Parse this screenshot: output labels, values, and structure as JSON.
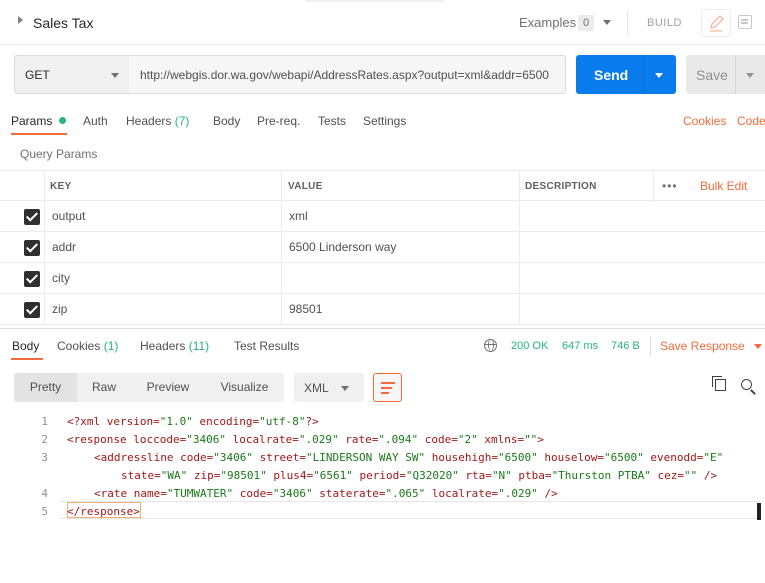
{
  "header": {
    "title": "Sales Tax",
    "examples_label": "Examples",
    "examples_count": "0",
    "build_label": "BUILD"
  },
  "request": {
    "method": "GET",
    "url": "http://webgis.dor.wa.gov/webapi/AddressRates.aspx?output=xml&addr=6500",
    "send_label": "Send",
    "save_label": "Save"
  },
  "request_tabs": {
    "params": "Params",
    "auth": "Auth",
    "headers": "Headers",
    "headers_count": "(7)",
    "body": "Body",
    "prereq": "Pre-req.",
    "tests": "Tests",
    "settings": "Settings",
    "cookies": "Cookies",
    "code": "Code"
  },
  "query_params": {
    "title": "Query Params",
    "columns": {
      "key": "KEY",
      "value": "VALUE",
      "description": "DESCRIPTION"
    },
    "more": "•••",
    "bulk_edit": "Bulk Edit",
    "rows": [
      {
        "key": "output",
        "value": "xml",
        "description": ""
      },
      {
        "key": "addr",
        "value": "6500 Linderson way",
        "description": ""
      },
      {
        "key": "city",
        "value": "",
        "description": ""
      },
      {
        "key": "zip",
        "value": "98501",
        "description": ""
      }
    ]
  },
  "response_tabs": {
    "body": "Body",
    "cookies": "Cookies",
    "cookies_count": "(1)",
    "headers": "Headers",
    "headers_count": "(11)",
    "test_results": "Test Results"
  },
  "response_status": {
    "status": "200 OK",
    "time": "647 ms",
    "size": "746 B",
    "save_response": "Save Response"
  },
  "view": {
    "pretty": "Pretty",
    "raw": "Raw",
    "preview": "Preview",
    "visualize": "Visualize",
    "format": "XML"
  },
  "code_lines": [
    "1",
    "2",
    "3",
    "4",
    "5"
  ],
  "code": {
    "l1": {
      "pi": "<?xml",
      "a1": " version=",
      "v1": "\"1.0\"",
      "a2": " encoding=",
      "v2": "\"utf-8\"",
      "end": "?>"
    },
    "l2": {
      "tag": "<response",
      "a1": " loccode=",
      "v1": "\"3406\"",
      "a2": " localrate=",
      "v2": "\".029\"",
      "a3": " rate=",
      "v3": "\".094\"",
      "a4": " code=",
      "v4": "\"2\"",
      "a5": " xmlns=",
      "v5": "\"\"",
      "end": ">"
    },
    "l3": {
      "tag": "<addressline",
      "a1": " code=",
      "v1": "\"3406\"",
      "a2": " street=",
      "v2": "\"LINDERSON WAY SW\"",
      "a3": " househigh=",
      "v3": "\"6500\"",
      "a4": " houselow=",
      "v4": "\"6500\"",
      "a5": " evenodd=",
      "v5": "\"E\""
    },
    "l3b": {
      "a1": "state=",
      "v1": "\"WA\"",
      "a2": " zip=",
      "v2": "\"98501\"",
      "a3": " plus4=",
      "v3": "\"6561\"",
      "a4": " period=",
      "v4": "\"Q32020\"",
      "a5": " rta=",
      "v5": "\"N\"",
      "a6": " ptba=",
      "v6": "\"Thurston PTBA\"",
      "a7": " cez=",
      "v7": "\"\"",
      "end": " />"
    },
    "l4": {
      "tag": "<rate",
      "a1": " name=",
      "v1": "\"TUMWATER\"",
      "a2": " code=",
      "v2": "\"3406\"",
      "a3": " staterate=",
      "v3": "\".065\"",
      "a4": " localrate=",
      "v4": "\".029\"",
      "end": " />"
    },
    "l5": {
      "tag": "</response",
      "end": ">"
    }
  },
  "colors": {
    "accent": "#f26b3a",
    "send": "#097bed",
    "success": "#26b47f"
  }
}
